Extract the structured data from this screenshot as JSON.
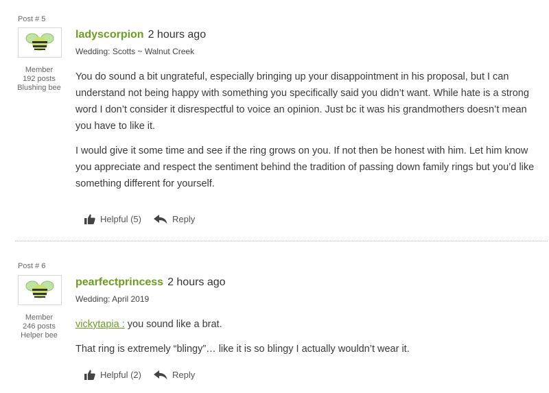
{
  "posts": [
    {
      "post_number": "Post # 5",
      "username": "ladyscorpion",
      "time": "2 hours ago",
      "wedding": "Wedding: Scotts ~ Walnut Creek",
      "member_label": "Member",
      "posts_count": "192 posts",
      "rank": "Blushing bee",
      "paragraphs": [
        "You do sound a bit ungrateful, especially bringing up your disappointment in his proposal, but I can understand not being happy with something you specifically said you didn’t want. While hate is a strong word I don’t consider it disrespectful to voice an opinion. Just bc it was his grandmothers doesn’t mean you have to like it.",
        "I would give it some time and see if the ring grows on you. If not then be honest with him. Let him know you appreciate and respect the sentiment behind the tradition of passing down family rings but you’d like something different for yourself."
      ],
      "helpful_label": "Helpful (5)",
      "reply_label": "Reply"
    },
    {
      "post_number": "Post # 6",
      "username": "pearfectprincess",
      "time": "2 hours ago",
      "wedding": "Wedding: April 2019",
      "member_label": "Member",
      "posts_count": "246 posts",
      "rank": "Helper bee",
      "mention": "vickytapia :",
      "first_line": "you sound like a brat.",
      "second_line": "That ring is extremely “blingy”… like it is so blingy I actually wouldn’t wear it.",
      "helpful_label": "Helpful (2)",
      "reply_label": "Reply"
    }
  ],
  "colors": {
    "username": "#6c9d1f",
    "bee_body": "#c9df6f",
    "bee_stripe": "#333333",
    "bee_wing": "#bfe3a3"
  },
  "icons": {
    "avatar": "bee-icon",
    "helpful": "thumbs-up-icon",
    "reply": "reply-arrow-icon"
  }
}
